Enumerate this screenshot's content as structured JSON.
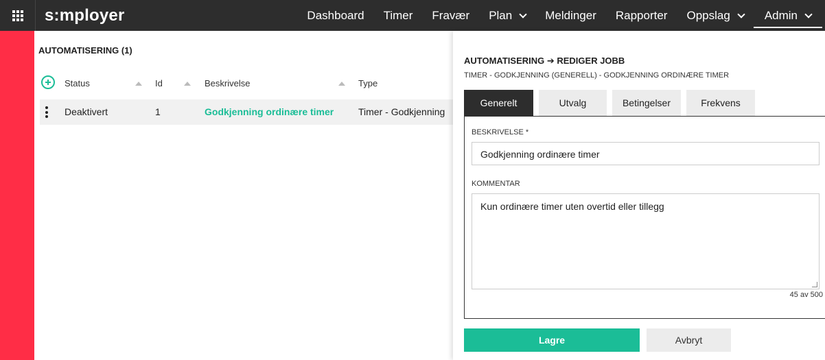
{
  "header": {
    "logo": "s:mployer",
    "nav": [
      {
        "label": "Dashboard"
      },
      {
        "label": "Timer"
      },
      {
        "label": "Fravær"
      },
      {
        "label": "Plan"
      },
      {
        "label": "Meldinger"
      },
      {
        "label": "Rapporter"
      },
      {
        "label": "Oppslag"
      },
      {
        "label": "Admin"
      }
    ]
  },
  "list": {
    "title": "AUTOMATISERING (1)",
    "columns": [
      "Status",
      "Id",
      "Beskrivelse",
      "Type"
    ],
    "rows": [
      {
        "status": "Deaktivert",
        "id": "1",
        "beskrivelse": "Godkjenning ordinære timer",
        "type": "Timer - Godkjenning"
      }
    ]
  },
  "panel": {
    "title": "AUTOMATISERING ➔ REDIGER JOBB",
    "subtitle": "TIMER - GODKJENNING (GENERELL) - GODKJENNING ORDINÆRE TIMER",
    "tabs": [
      "Generelt",
      "Utvalg",
      "Betingelser",
      "Frekvens"
    ],
    "form": {
      "beskrivelse_label": "BESKRIVELSE *",
      "beskrivelse_value": "Godkjenning ordinære timer",
      "kommentar_label": "KOMMENTAR",
      "kommentar_value": "Kun ordinære timer uten overtid eller tillegg",
      "counter": "45 av 500"
    },
    "save_label": "Lagre",
    "cancel_label": "Avbryt"
  },
  "colors": {
    "brand_red": "#ff2d46",
    "accent_green": "#1bbd97",
    "topbar": "#2d2d2d"
  }
}
